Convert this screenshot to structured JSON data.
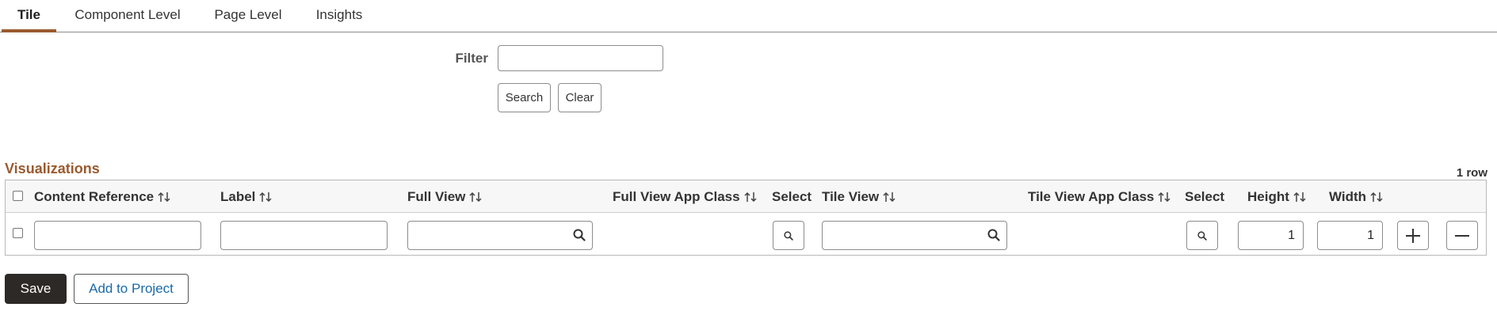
{
  "tabs": [
    {
      "label": "Tile",
      "active": true
    },
    {
      "label": "Component Level",
      "active": false
    },
    {
      "label": "Page Level",
      "active": false
    },
    {
      "label": "Insights",
      "active": false
    }
  ],
  "filter": {
    "label": "Filter",
    "value": "",
    "search_label": "Search",
    "clear_label": "Clear"
  },
  "grid": {
    "title": "Visualizations",
    "row_count": "1 row",
    "columns": {
      "content_reference": "Content Reference",
      "label": "Label",
      "full_view": "Full View",
      "full_view_app_class": "Full View App Class",
      "select_full": "Select",
      "tile_view": "Tile View",
      "tile_view_app_class": "Tile View App Class",
      "select_tile": "Select",
      "height": "Height",
      "width": "Width"
    },
    "rows": [
      {
        "content_reference": "",
        "label": "",
        "full_view": "",
        "tile_view": "",
        "height": "1",
        "width": "1"
      }
    ]
  },
  "footer": {
    "save_label": "Save",
    "add_to_project_label": "Add to Project"
  },
  "colors": {
    "accent": "#9b5a2e",
    "link": "#1a6aa8",
    "primary_button": "#2d2926"
  }
}
